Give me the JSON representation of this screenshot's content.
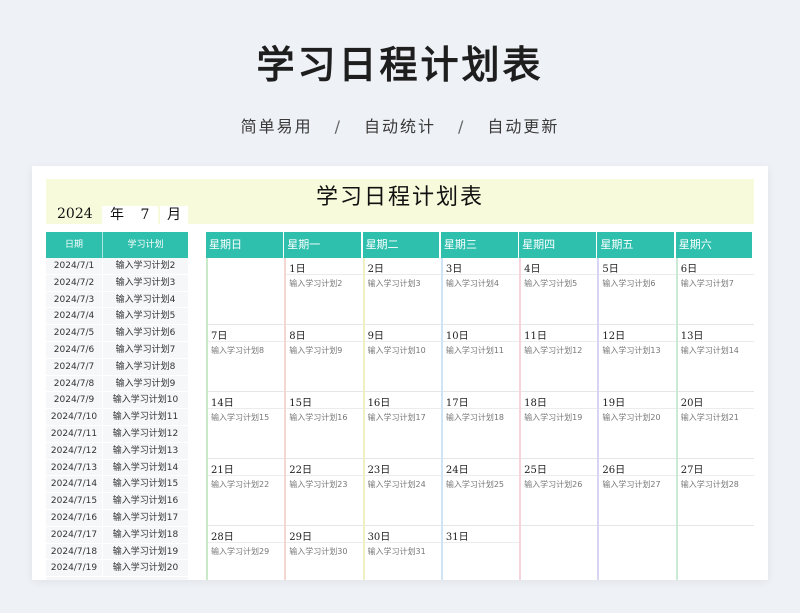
{
  "header": {
    "title": "学习日程计划表",
    "tagline": [
      "简单易用",
      "自动统计",
      "自动更新"
    ],
    "separator": "/"
  },
  "sheet": {
    "title": "学习日程计划表",
    "year": "2024",
    "year_unit": "年",
    "month": "7",
    "month_unit": "月"
  },
  "list": {
    "headers": [
      "日期",
      "学习计划"
    ],
    "rows": [
      {
        "date": "2024/7/1",
        "plan": "输入学习计划2"
      },
      {
        "date": "2024/7/2",
        "plan": "输入学习计划3"
      },
      {
        "date": "2024/7/3",
        "plan": "输入学习计划4"
      },
      {
        "date": "2024/7/4",
        "plan": "输入学习计划5"
      },
      {
        "date": "2024/7/5",
        "plan": "输入学习计划6"
      },
      {
        "date": "2024/7/6",
        "plan": "输入学习计划7"
      },
      {
        "date": "2024/7/7",
        "plan": "输入学习计划8"
      },
      {
        "date": "2024/7/8",
        "plan": "输入学习计划9"
      },
      {
        "date": "2024/7/9",
        "plan": "输入学习计划10"
      },
      {
        "date": "2024/7/10",
        "plan": "输入学习计划11"
      },
      {
        "date": "2024/7/11",
        "plan": "输入学习计划12"
      },
      {
        "date": "2024/7/12",
        "plan": "输入学习计划13"
      },
      {
        "date": "2024/7/13",
        "plan": "输入学习计划14"
      },
      {
        "date": "2024/7/14",
        "plan": "输入学习计划15"
      },
      {
        "date": "2024/7/15",
        "plan": "输入学习计划16"
      },
      {
        "date": "2024/7/16",
        "plan": "输入学习计划17"
      },
      {
        "date": "2024/7/17",
        "plan": "输入学习计划18"
      },
      {
        "date": "2024/7/18",
        "plan": "输入学习计划19"
      },
      {
        "date": "2024/7/19",
        "plan": "输入学习计划20"
      }
    ]
  },
  "calendar": {
    "weekdays": [
      "星期日",
      "星期一",
      "星期二",
      "星期三",
      "星期四",
      "星期五",
      "星期六"
    ],
    "column_colors": [
      "#c9e9c9",
      "#f5d6d0",
      "#eef2c2",
      "#cfe5f5",
      "#f7d4dc",
      "#d8d5f2",
      "#c9ead5"
    ],
    "header_color": "#2ebfad",
    "weeks": [
      [
        null,
        {
          "day": "1日",
          "plan": "输入学习计划2"
        },
        {
          "day": "2日",
          "plan": "输入学习计划3"
        },
        {
          "day": "3日",
          "plan": "输入学习计划4"
        },
        {
          "day": "4日",
          "plan": "输入学习计划5"
        },
        {
          "day": "5日",
          "plan": "输入学习计划6"
        },
        {
          "day": "6日",
          "plan": "输入学习计划7"
        }
      ],
      [
        {
          "day": "7日",
          "plan": "输入学习计划8"
        },
        {
          "day": "8日",
          "plan": "输入学习计划9"
        },
        {
          "day": "9日",
          "plan": "输入学习计划10"
        },
        {
          "day": "10日",
          "plan": "输入学习计划11"
        },
        {
          "day": "11日",
          "plan": "输入学习计划12"
        },
        {
          "day": "12日",
          "plan": "输入学习计划13"
        },
        {
          "day": "13日",
          "plan": "输入学习计划14"
        }
      ],
      [
        {
          "day": "14日",
          "plan": "输入学习计划15"
        },
        {
          "day": "15日",
          "plan": "输入学习计划16"
        },
        {
          "day": "16日",
          "plan": "输入学习计划17"
        },
        {
          "day": "17日",
          "plan": "输入学习计划18"
        },
        {
          "day": "18日",
          "plan": "输入学习计划19"
        },
        {
          "day": "19日",
          "plan": "输入学习计划20"
        },
        {
          "day": "20日",
          "plan": "输入学习计划21"
        }
      ],
      [
        {
          "day": "21日",
          "plan": "输入学习计划22"
        },
        {
          "day": "22日",
          "plan": "输入学习计划23"
        },
        {
          "day": "23日",
          "plan": "输入学习计划24"
        },
        {
          "day": "24日",
          "plan": "输入学习计划25"
        },
        {
          "day": "25日",
          "plan": "输入学习计划26"
        },
        {
          "day": "26日",
          "plan": "输入学习计划27"
        },
        {
          "day": "27日",
          "plan": "输入学习计划28"
        }
      ],
      [
        {
          "day": "28日",
          "plan": "输入学习计划29"
        },
        {
          "day": "29日",
          "plan": "输入学习计划30"
        },
        {
          "day": "30日",
          "plan": "输入学习计划31"
        },
        {
          "day": "31日",
          "plan": ""
        },
        null,
        null,
        null
      ]
    ]
  }
}
